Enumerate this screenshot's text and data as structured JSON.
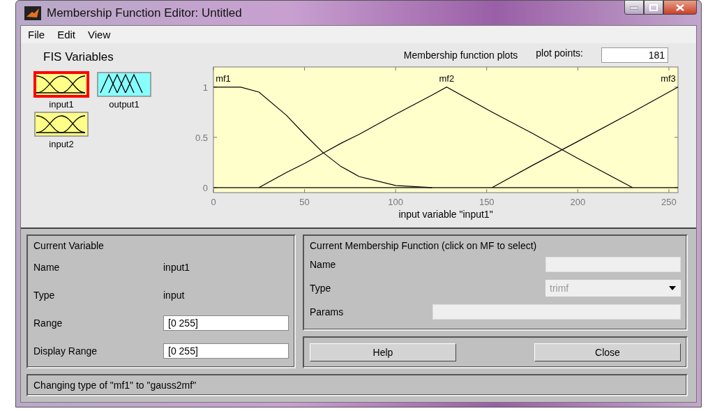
{
  "window": {
    "title": "Membership Function Editor: Untitled"
  },
  "menu": [
    "File",
    "Edit",
    "View"
  ],
  "fis_variables": {
    "title": "FIS Variables",
    "items": [
      {
        "label": "input1",
        "kind": "input",
        "selected": true
      },
      {
        "label": "output1",
        "kind": "output",
        "selected": false
      },
      {
        "label": "input2",
        "kind": "input",
        "selected": false
      }
    ]
  },
  "plot": {
    "title": "Membership function plots",
    "plot_points_label": "plot points:",
    "plot_points": "181",
    "chart_data": {
      "type": "line",
      "xlabel": "input variable \"input1\"",
      "x": [
        0,
        15,
        25,
        40,
        50,
        60,
        70,
        80,
        100,
        120,
        128,
        153,
        175,
        200,
        230,
        255
      ],
      "series": [
        {
          "name": "mf1",
          "color": "#000000",
          "values": [
            1,
            1,
            0.95,
            0.72,
            0.53,
            0.35,
            0.21,
            0.11,
            0.02,
            0,
            null,
            null,
            null,
            null,
            null,
            null
          ]
        },
        {
          "name": "mf2",
          "color": "#000000",
          "values": [
            null,
            null,
            0,
            0.15,
            0.24,
            0.34,
            0.44,
            0.53,
            0.73,
            0.92,
            1,
            0.75,
            0.54,
            0.29,
            0,
            null
          ]
        },
        {
          "name": "mf3",
          "color": "#000000",
          "values": [
            null,
            null,
            null,
            null,
            null,
            null,
            null,
            null,
            null,
            null,
            null,
            0,
            0.22,
            0.46,
            0.75,
            1
          ]
        }
      ],
      "xlim": [
        0,
        255
      ],
      "ylim": [
        -0.05,
        1.2
      ],
      "xticks": [
        0,
        50,
        100,
        150,
        200,
        250
      ],
      "yticks": [
        0,
        0.5,
        1
      ]
    }
  },
  "current_variable": {
    "title": "Current Variable",
    "rows": [
      {
        "label": "Name",
        "value": "input1",
        "kind": "text"
      },
      {
        "label": "Type",
        "value": "input",
        "kind": "text"
      },
      {
        "label": "Range",
        "value": "[0 255]",
        "kind": "field"
      },
      {
        "label": "Display Range",
        "value": "[0 255]",
        "kind": "field"
      }
    ]
  },
  "current_mf": {
    "title": "Current Membership Function (click on MF to select)",
    "rows": [
      {
        "label": "Name",
        "kind": "field"
      },
      {
        "label": "Type",
        "value": "trimf",
        "kind": "select"
      },
      {
        "label": "Params",
        "kind": "wide"
      }
    ]
  },
  "buttons": [
    "Help",
    "Close"
  ],
  "status": "Changing type of \"mf1\" to \"gauss2mf\""
}
